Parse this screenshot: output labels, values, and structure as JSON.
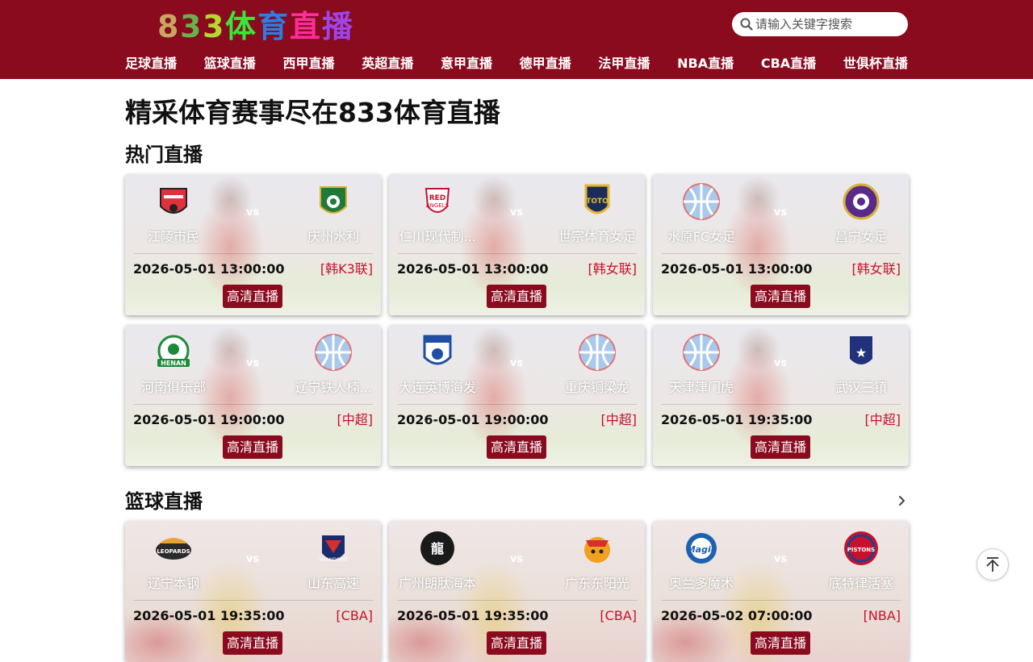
{
  "header": {
    "logo": {
      "d1": "8",
      "d2": "3",
      "d3": "3",
      "c1": "体",
      "c2": "育",
      "c3": "直",
      "c4": "播"
    },
    "search_placeholder": "请输入关键字搜索",
    "nav": [
      "足球直播",
      "篮球直播",
      "西甲直播",
      "英超直播",
      "意甲直播",
      "德甲直播",
      "法甲直播",
      "NBA直播",
      "CBA直播",
      "世俱杯直播"
    ],
    "colors": {
      "header_bg": "#8a0b1e",
      "accent": "#c8102e"
    }
  },
  "page_title": "精采体育赛事尽在833体育直播",
  "sections": [
    {
      "title": "热门直播",
      "more_icon": ""
    },
    {
      "title": "篮球直播",
      "more_icon": "chevron-right-icon"
    }
  ],
  "vs_label": "vs",
  "button_label": "高清直播",
  "hot_matches": [
    {
      "home": "江陵市民",
      "away": "庆州水利",
      "time": "2026-05-01 13:00:00",
      "league": "[韩K3联]",
      "home_logo": "gangneung-badge",
      "away_logo": "gyeongju-badge"
    },
    {
      "home": "仁川现代制...",
      "away": "世宗体育女足",
      "time": "2026-05-01 13:00:00",
      "league": "[韩女联]",
      "home_logo": "red-angels-badge",
      "away_logo": "sportstoto-badge"
    },
    {
      "home": "水原FC女足",
      "away": "昌宁女足",
      "time": "2026-05-01 13:00:00",
      "league": "[韩女联]",
      "home_logo": "default-ball-badge",
      "away_logo": "changnyeong-badge"
    },
    {
      "home": "河南俱乐部",
      "away": "辽宁铁人楠...",
      "time": "2026-05-01 19:00:00",
      "league": "[中超]",
      "home_logo": "henan-badge",
      "away_logo": "default-ball-badge"
    },
    {
      "home": "大连英博海发",
      "away": "重庆铜梁龙",
      "time": "2026-05-01 19:00:00",
      "league": "[中超]",
      "home_logo": "dalian-badge",
      "away_logo": "default-ball-badge"
    },
    {
      "home": "天津津门虎",
      "away": "武汉三镇",
      "time": "2026-05-01 19:35:00",
      "league": "[中超]",
      "home_logo": "default-ball-badge",
      "away_logo": "wuhan-badge"
    }
  ],
  "basketball_matches": [
    {
      "home": "辽宁本钢",
      "away": "山东高速",
      "time": "2026-05-01 19:35:00",
      "league": "[CBA]",
      "home_logo": "liaoning-leopards-badge",
      "away_logo": "shandong-badge"
    },
    {
      "home": "广州朗肽海本",
      "away": "广东东阳光",
      "time": "2026-05-01 19:35:00",
      "league": "[CBA]",
      "home_logo": "guangzhou-badge",
      "away_logo": "guangdong-tigers-badge"
    },
    {
      "home": "奥兰多魔术",
      "away": "底特律活塞",
      "time": "2026-05-02 07:00:00",
      "league": "[NBA]",
      "home_logo": "orlando-magic-badge",
      "away_logo": "detroit-pistons-badge"
    }
  ]
}
